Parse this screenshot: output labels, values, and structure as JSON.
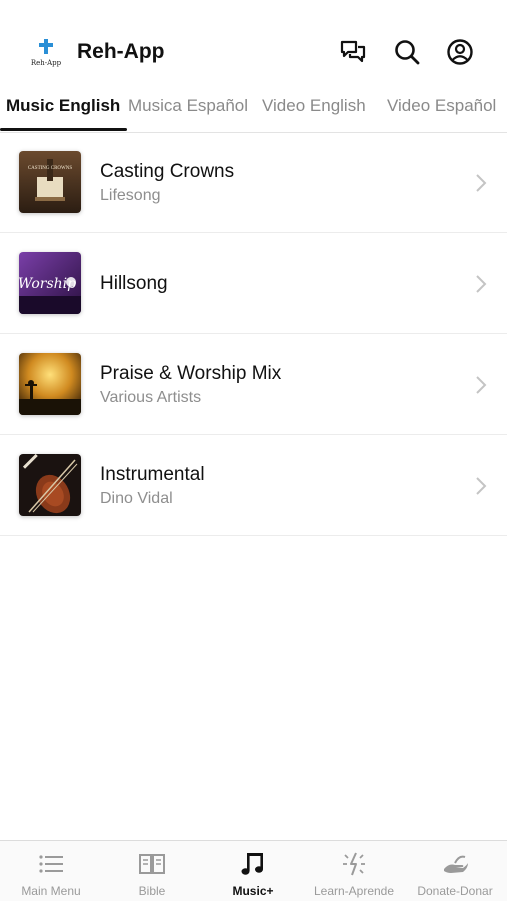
{
  "header": {
    "app_title": "Reh-App",
    "logo_text": "Reh-App",
    "icons": [
      "chat-icon",
      "search-icon",
      "account-icon"
    ]
  },
  "tabs": [
    {
      "label": "Music English",
      "active": true
    },
    {
      "label": "Musica Español",
      "active": false
    },
    {
      "label": "Video English",
      "active": false
    },
    {
      "label": "Video Español",
      "active": false
    }
  ],
  "items": [
    {
      "title": "Casting Crowns",
      "subtitle": "Lifesong",
      "artwork_text": "CASTING CROWNS"
    },
    {
      "title": "Hillsong",
      "subtitle": "",
      "artwork_text": "Worship"
    },
    {
      "title": "Praise & Worship Mix",
      "subtitle": "Various Artists"
    },
    {
      "title": "Instrumental",
      "subtitle": "Dino Vidal"
    }
  ],
  "bottom_nav": [
    {
      "label": "Main Menu",
      "icon": "list-icon",
      "active": false
    },
    {
      "label": "Bible",
      "icon": "book-icon",
      "active": false
    },
    {
      "label": "Music+",
      "icon": "music-note-icon",
      "active": true
    },
    {
      "label": "Learn-Aprende",
      "icon": "sparkle-icon",
      "active": false
    },
    {
      "label": "Donate-Donar",
      "icon": "hand-icon",
      "active": false
    }
  ],
  "colors": {
    "accent": "#111111",
    "inactive": "#8a8a8a",
    "logo_cross": "#2a8fd6"
  }
}
